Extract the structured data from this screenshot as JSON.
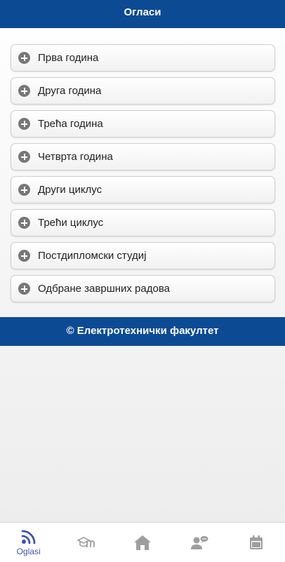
{
  "header": {
    "title": "Огласи"
  },
  "menu": {
    "items": [
      {
        "label": "Прва година"
      },
      {
        "label": "Друга година"
      },
      {
        "label": "Трећа година"
      },
      {
        "label": "Четврта година"
      },
      {
        "label": "Други циклус"
      },
      {
        "label": "Трећи циклус"
      },
      {
        "label": "Постдипломски студиј"
      },
      {
        "label": "Одбране завршних радова"
      }
    ]
  },
  "footer": {
    "text": "© Електротехнички факултет"
  },
  "tabbar": {
    "tabs": [
      {
        "icon": "rss-icon",
        "label": "Oglasi",
        "active": true
      },
      {
        "icon": "school-icon",
        "label": "",
        "active": false
      },
      {
        "icon": "home-icon",
        "label": "",
        "active": false
      },
      {
        "icon": "user-chat-icon",
        "label": "",
        "active": false
      },
      {
        "icon": "calendar-icon",
        "label": "",
        "active": false
      }
    ]
  },
  "colors": {
    "header_bg": "#0d4a94",
    "active_tab": "#3f51b5",
    "inactive_tab": "#9e9e9e"
  }
}
